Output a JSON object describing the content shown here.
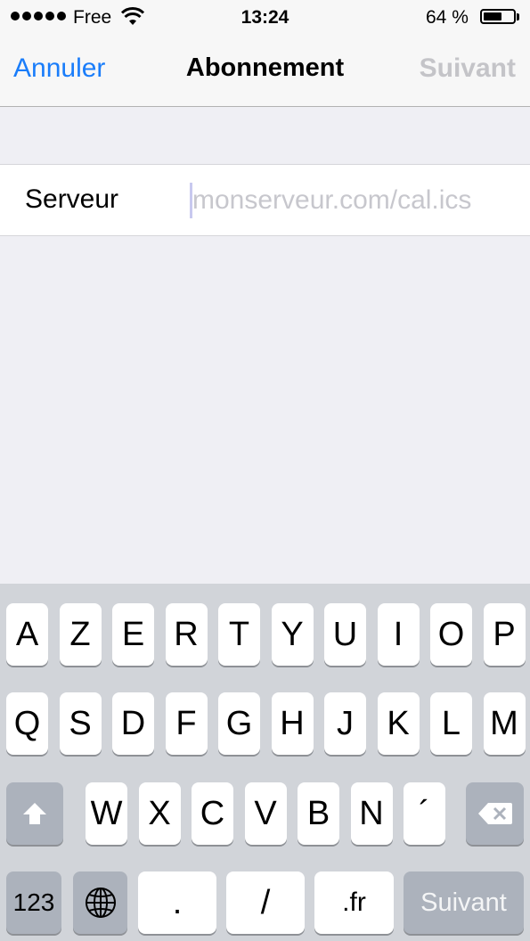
{
  "status_bar": {
    "carrier": "Free",
    "time": "13:24",
    "battery": "64 %",
    "battery_level": 0.64,
    "signal_dots": 5
  },
  "nav": {
    "cancel_label": "Annuler",
    "title": "Abonnement",
    "next_label": "Suivant"
  },
  "form": {
    "server_label": "Serveur",
    "server_placeholder": "monserveur.com/cal.ics",
    "server_value": ""
  },
  "keyboard": {
    "row1": [
      "A",
      "Z",
      "E",
      "R",
      "T",
      "Y",
      "U",
      "I",
      "O",
      "P"
    ],
    "row2": [
      "Q",
      "S",
      "D",
      "F",
      "G",
      "H",
      "J",
      "K",
      "L",
      "M"
    ],
    "row3": [
      "W",
      "X",
      "C",
      "V",
      "B",
      "N",
      "´"
    ],
    "numbers_label": "123",
    "dot_label": ".",
    "slash_label": "/",
    "fr_label": ".fr",
    "return_label": "Suivant",
    "shift_icon": "shift-icon",
    "delete_icon": "delete-icon",
    "globe_icon": "globe-icon"
  },
  "colors": {
    "accent": "#1a7dfa",
    "disabled": "#c4c4c8",
    "background": "#efeff4",
    "keyboard_bg": "#d1d4d9"
  }
}
